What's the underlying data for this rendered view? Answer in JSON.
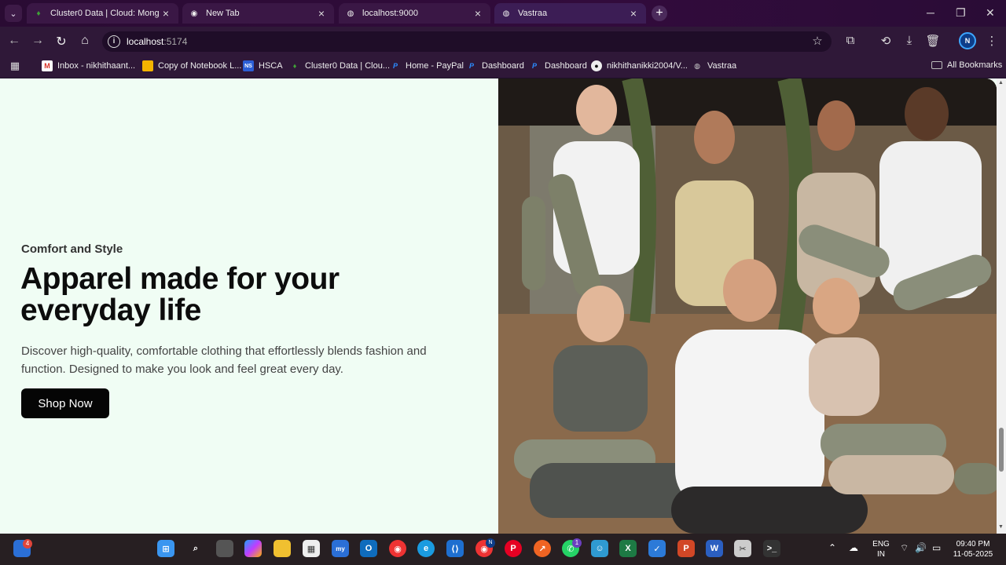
{
  "browser": {
    "tabs": [
      {
        "title": "Cluster0 Data | Cloud: MongoDB",
        "icon": "leaf-icon",
        "active": false
      },
      {
        "title": "New Tab",
        "icon": "chrome-icon",
        "active": false
      },
      {
        "title": "localhost:9000",
        "icon": "globe-icon",
        "active": false
      },
      {
        "title": "Vastraa",
        "icon": "globe-icon",
        "active": true
      }
    ],
    "url_host": "localhost",
    "url_port": ":5174",
    "bookmarks": [
      {
        "label": "Inbox - nikhithaant...",
        "icon": "gmail-icon"
      },
      {
        "label": "Copy of Notebook L...",
        "icon": "slides-icon"
      },
      {
        "label": "HSCA",
        "icon": "ns-icon"
      },
      {
        "label": "Cluster0 Data | Clou...",
        "icon": "leaf-icon"
      },
      {
        "label": "Home - PayPal",
        "icon": "paypal-icon"
      },
      {
        "label": "Dashboard",
        "icon": "paypal-icon"
      },
      {
        "label": "Dashboard",
        "icon": "paypal-icon"
      },
      {
        "label": "nikhithanikki2004/V...",
        "icon": "github-icon"
      },
      {
        "label": "Vastraa",
        "icon": "globe-icon"
      }
    ],
    "all_bookmarks": "All Bookmarks",
    "profile_initial": "N"
  },
  "hero": {
    "eyebrow": "Comfort and Style",
    "headline": "Apparel made for your everyday life",
    "description": "Discover high-quality, comfortable clothing that effortlessly blends fashion and function. Designed to make you look and feel great every day.",
    "cta": "Shop Now"
  },
  "taskbar": {
    "widgets_badge": "4",
    "whatsapp_badge": "1",
    "chrome_badge": "N",
    "lang_line1": "ENG",
    "lang_line2": "IN",
    "time": "09:40 PM",
    "date": "11-05-2025"
  }
}
